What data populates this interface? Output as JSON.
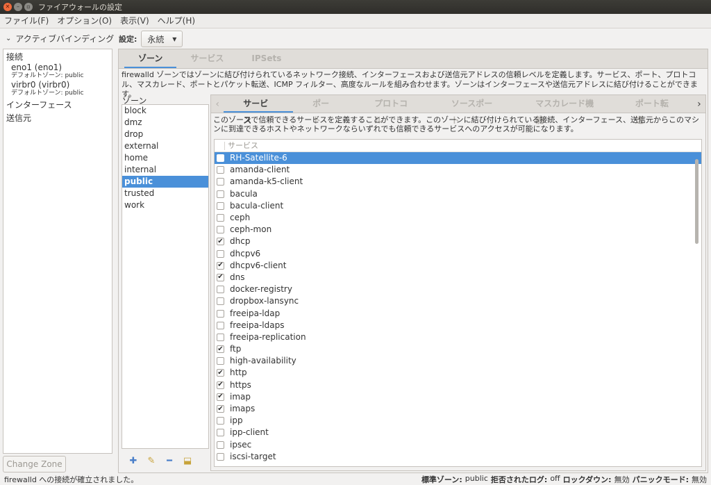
{
  "window": {
    "title": "ファイアウォールの設定"
  },
  "menubar": [
    "ファイル(F)",
    "オプション(O)",
    "表示(V)",
    "ヘルプ(H)"
  ],
  "active_bindings": {
    "header": "アクティブバインディング",
    "connections_label": "接続",
    "connections": [
      {
        "name": "eno1 (eno1)",
        "zone": "デフォルトゾーン: public"
      },
      {
        "name": "virbr0 (virbr0)",
        "zone": "デフォルトゾーン: public"
      }
    ],
    "interfaces_label": "インターフェース",
    "sources_label": "送信元",
    "change_zone": "Change Zone"
  },
  "config": {
    "label": "設定:",
    "value": "永続"
  },
  "top_tabs": [
    "ゾーン",
    "サービス",
    "IPSets"
  ],
  "zone_description": "firewalld ゾーンではゾーンに結び付けられているネットワーク接続、インターフェースおよび送信元アドレスの信頼レベルを定義します。サービス、ポート、プロトコル、マスカレード、ポートとパケット転送、ICMP フィルター、高度なルールを組み合わせます。ゾーンはインターフェースや送信元アドレスに結び付けることができます。",
  "zones": {
    "header": "ゾーン",
    "items": [
      "block",
      "dmz",
      "drop",
      "external",
      "home",
      "internal",
      "public",
      "trusted",
      "work"
    ],
    "selected": "public"
  },
  "detail_tabs": [
    "サービス",
    "ポート",
    "プロトコル",
    "ソースポート",
    "マスカレード機能",
    "ポート転送"
  ],
  "service_description": "このゾーンで信頼できるサービスを定義することができます。このゾーンに結び付けられている接続、インターフェース、送信元からこのマシンに到達できるホストやネットワークならいずれでも信頼できるサービスへのアクセスが可能になります。",
  "services": {
    "header": "サービス",
    "items": [
      {
        "name": "RH-Satellite-6",
        "checked": false,
        "selected": true
      },
      {
        "name": "amanda-client",
        "checked": false
      },
      {
        "name": "amanda-k5-client",
        "checked": false
      },
      {
        "name": "bacula",
        "checked": false
      },
      {
        "name": "bacula-client",
        "checked": false
      },
      {
        "name": "ceph",
        "checked": false
      },
      {
        "name": "ceph-mon",
        "checked": false
      },
      {
        "name": "dhcp",
        "checked": true
      },
      {
        "name": "dhcpv6",
        "checked": false
      },
      {
        "name": "dhcpv6-client",
        "checked": true
      },
      {
        "name": "dns",
        "checked": true
      },
      {
        "name": "docker-registry",
        "checked": false
      },
      {
        "name": "dropbox-lansync",
        "checked": false
      },
      {
        "name": "freeipa-ldap",
        "checked": false
      },
      {
        "name": "freeipa-ldaps",
        "checked": false
      },
      {
        "name": "freeipa-replication",
        "checked": false
      },
      {
        "name": "ftp",
        "checked": true
      },
      {
        "name": "high-availability",
        "checked": false
      },
      {
        "name": "http",
        "checked": true
      },
      {
        "name": "https",
        "checked": true
      },
      {
        "name": "imap",
        "checked": true
      },
      {
        "name": "imaps",
        "checked": true
      },
      {
        "name": "ipp",
        "checked": false
      },
      {
        "name": "ipp-client",
        "checked": false
      },
      {
        "name": "ipsec",
        "checked": false
      },
      {
        "name": "iscsi-target",
        "checked": false
      }
    ]
  },
  "status": {
    "message": "firewalld への接続が確立されました。",
    "default_zone_label": "標準ゾーン:",
    "default_zone": "public",
    "log_denied_label": "拒否されたログ:",
    "log_denied": "off",
    "lockdown_label": "ロックダウン:",
    "lockdown": "無効",
    "panic_label": "パニックモード:",
    "panic": "無効"
  }
}
